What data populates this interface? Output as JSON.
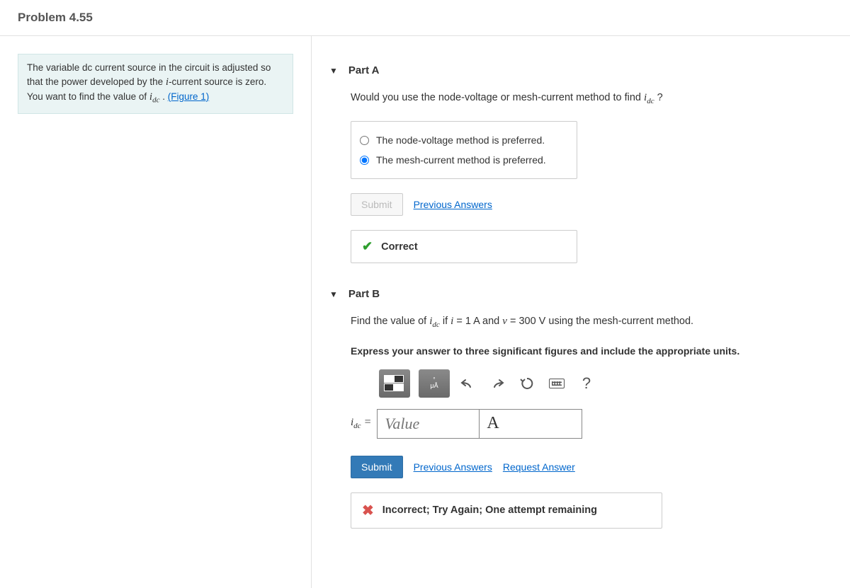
{
  "header": {
    "title": "Problem 4.55"
  },
  "intro": {
    "text_prefix": "The variable dc current source in the circuit is adjusted so that the power developed by the ",
    "text_math": "i",
    "text_mid": "-current source is zero. You want to find the value of ",
    "idc_sym": "i",
    "idc_sub": "dc",
    "text_suffix": " . ",
    "figure_link": "(Figure 1)"
  },
  "partA": {
    "title": "Part A",
    "question_prefix": "Would you use the node-voltage or mesh-current method to find ",
    "idc_sym": "i",
    "idc_sub": "dc",
    "question_suffix": " ?",
    "options": [
      "The node-voltage method is preferred.",
      "The mesh-current method is preferred."
    ],
    "selected_index": 1,
    "submit_label": "Submit",
    "prev_answers": "Previous Answers",
    "feedback": "Correct"
  },
  "partB": {
    "title": "Part B",
    "q_prefix": "Find the value of ",
    "idc_sym": "i",
    "idc_sub": "dc",
    "q_mid1": " if ",
    "i_sym": "i",
    "q_eq1": " = 1 A ",
    "q_and": " and ",
    "v_sym": "v",
    "q_eq2": " = 300 V ",
    "q_suffix": " using the mesh-current method.",
    "instruct": "Express your answer to three significant figures and include the appropriate units.",
    "answer_label_sym": "i",
    "answer_label_sub": "dc",
    "answer_label_eq": " = ",
    "value_placeholder": "Value",
    "unit_value": "A",
    "submit_label": "Submit",
    "prev_answers": "Previous Answers",
    "request_answer": "Request Answer",
    "feedback": "Incorrect; Try Again; One attempt remaining",
    "help_q": "?",
    "greek_label1": "μÅ"
  }
}
